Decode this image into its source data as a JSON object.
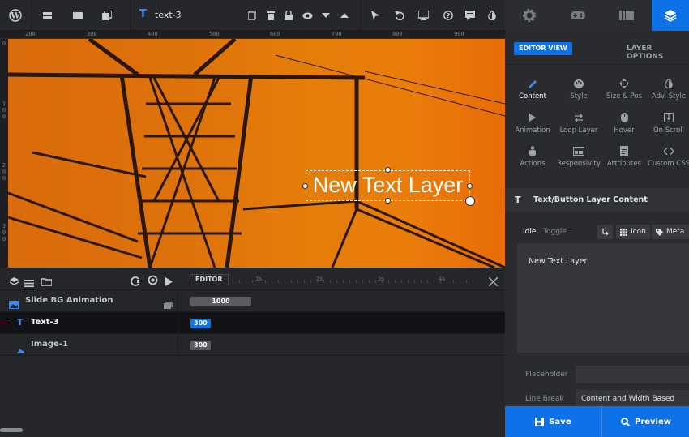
{
  "toolbar": {
    "layer_name": "text-3",
    "layer_type_icon": "T"
  },
  "ruler": {
    "h_labels": [
      "200",
      "300",
      "400",
      "500",
      "600",
      "700",
      "800",
      "900"
    ],
    "v_labels": [
      "0",
      "1\n0\n0",
      "2\n0\n0",
      "3\n0\n0"
    ]
  },
  "canvas": {
    "text_layer": "New Text Layer"
  },
  "timeline": {
    "editor_label": "EDITOR",
    "ticks": [
      "1s",
      "2s",
      "3s",
      "4s"
    ],
    "rows": [
      {
        "label": "Slide BG Animation",
        "badge": "1000"
      },
      {
        "label": "Text-3",
        "badge": "300"
      },
      {
        "label": "Image-1",
        "badge": "300"
      }
    ]
  },
  "sidebar": {
    "editor_view": "EDITOR VIEW",
    "layer_options": "LAYER OPTIONS",
    "grid": [
      {
        "label": "Content",
        "icon": "pencil-icon"
      },
      {
        "label": "Style",
        "icon": "palette-icon"
      },
      {
        "label": "Size & Pos",
        "icon": "move-icon"
      },
      {
        "label": "Adv. Style",
        "icon": "contrast-icon"
      },
      {
        "label": "Animation",
        "icon": "play-icon"
      },
      {
        "label": "Loop Layer",
        "icon": "loop-icon"
      },
      {
        "label": "Hover",
        "icon": "mouse-icon"
      },
      {
        "label": "On Scroll",
        "icon": "scroll-icon"
      },
      {
        "label": "Actions",
        "icon": "hand-icon"
      },
      {
        "label": "Responsivity",
        "icon": "responsive-icon"
      },
      {
        "label": "Attributes",
        "icon": "document-icon"
      },
      {
        "label": "Custom CSS",
        "icon": "code-icon"
      }
    ],
    "section_title": "Text/Button Layer Content",
    "idle": "Idle",
    "toggle": "Toggle",
    "icon_chip": "Icon",
    "meta_chip": "Meta",
    "content_text": "New Text Layer",
    "placeholder_label": "Placeholder",
    "placeholder_value": "",
    "linebreak_label": "Line Break",
    "linebreak_value": "Content and Width Based"
  },
  "footer": {
    "save": "Save",
    "preview": "Preview"
  },
  "colors": {
    "accent": "#0d72e8",
    "canvas_bg": "#e37509"
  }
}
